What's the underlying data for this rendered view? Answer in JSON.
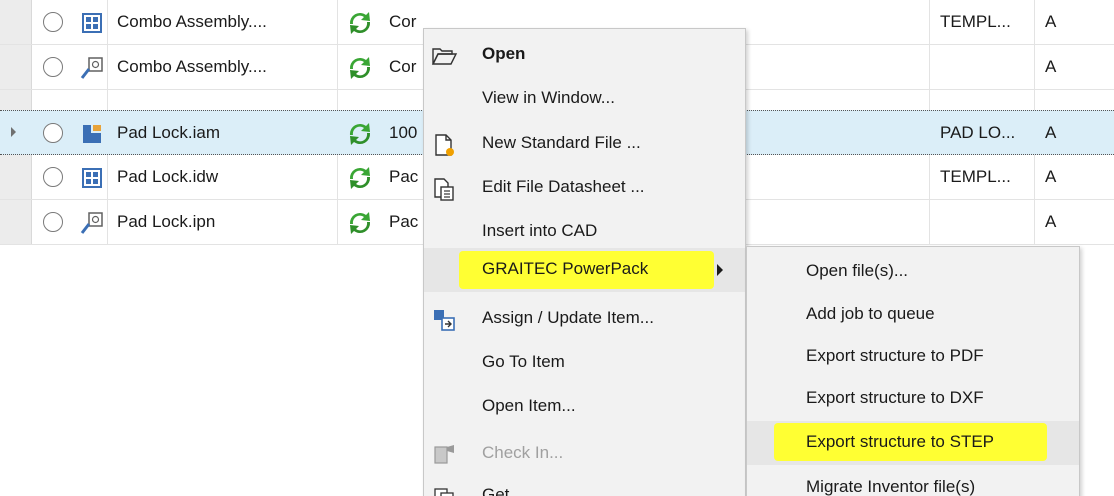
{
  "rows": [
    {
      "name": "Combo Assembly....",
      "status": "Cor",
      "template": "TEMPL...",
      "rev": "A",
      "type_icon": "drawing-icon",
      "status_icon": "recycle-icon"
    },
    {
      "name": "Combo Assembly....",
      "status": "Cor",
      "template": "",
      "rev": "A",
      "type_icon": "presentation-icon",
      "status_icon": "recycle-icon"
    },
    {
      "name": "Pad Lock.iam",
      "status": "100",
      "template": "PAD LO...",
      "rev": "A",
      "type_icon": "assembly-icon",
      "status_icon": "recycle-icon",
      "selected": true
    },
    {
      "name": "Pad Lock.idw",
      "status": "Pac",
      "template": "TEMPL...",
      "rev": "A",
      "type_icon": "drawing-icon",
      "status_icon": "recycle-icon"
    },
    {
      "name": "Pad Lock.ipn",
      "status": "Pac",
      "template": "",
      "rev": "A",
      "type_icon": "presentation-icon",
      "status_icon": "recycle-icon"
    }
  ],
  "context_menu": {
    "items": [
      {
        "label": "Open",
        "icon": "folder-open-icon",
        "bold": true
      },
      {
        "label": "View in Window..."
      },
      {
        "label": "New Standard File ...",
        "icon": "new-file-icon"
      },
      {
        "label": "Edit File Datasheet ...",
        "icon": "datasheet-icon"
      },
      {
        "label": "Insert into CAD"
      },
      {
        "label": "GRAITEC PowerPack",
        "submenu": true,
        "highlighted": true
      },
      {
        "label": "Assign / Update Item...",
        "icon": "assign-item-icon"
      },
      {
        "label": "Go To Item"
      },
      {
        "label": "Open Item..."
      },
      {
        "label": "Check In...",
        "icon": "check-in-icon",
        "disabled": true
      },
      {
        "label": "Get...",
        "icon": "get-icon"
      }
    ]
  },
  "submenu": {
    "items": [
      {
        "label": "Open file(s)..."
      },
      {
        "label": "Add job to queue"
      },
      {
        "label": "Export structure to PDF"
      },
      {
        "label": "Export structure to DXF"
      },
      {
        "label": "Export structure to STEP",
        "highlighted": true
      },
      {
        "label": "Migrate Inventor file(s)"
      }
    ]
  },
  "colors": {
    "highlight": "#ffff33",
    "selected_row": "#dbeef8",
    "status_green": "#3aa635"
  }
}
